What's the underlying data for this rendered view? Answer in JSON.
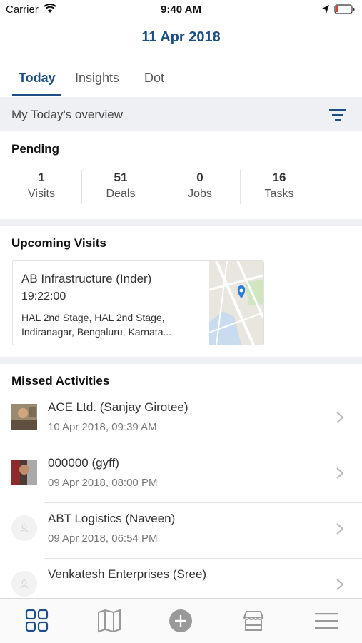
{
  "status_bar": {
    "carrier": "Carrier",
    "time": "9:40 AM",
    "icons": [
      "wifi-icon",
      "location-arrow-icon",
      "battery-icon"
    ]
  },
  "header": {
    "date": "11 Apr 2018"
  },
  "tabs": [
    {
      "label": "Today",
      "active": true
    },
    {
      "label": "Insights",
      "active": false
    },
    {
      "label": "Dot",
      "active": false
    }
  ],
  "overview": {
    "label": "My Today's overview",
    "icon": "filter-icon"
  },
  "pending": {
    "title": "Pending",
    "stats": [
      {
        "value": "1",
        "label": "Visits"
      },
      {
        "value": "51",
        "label": "Deals"
      },
      {
        "value": "0",
        "label": "Jobs"
      },
      {
        "value": "16",
        "label": "Tasks"
      }
    ]
  },
  "upcoming": {
    "title": "Upcoming Visits",
    "visit": {
      "name": "AB Infrastructure (Inder)",
      "time": "19:22:00",
      "address_line1": "HAL 2nd Stage, HAL 2nd Stage,",
      "address_line2": "Indiranagar, Bengaluru, Karnata..."
    }
  },
  "missed": {
    "title": "Missed Activities",
    "items": [
      {
        "title": "ACE Ltd. (Sanjay Girotee)",
        "time": "10 Apr 2018, 09:39 AM",
        "avatar": "photo"
      },
      {
        "title": "000000 (gyff)",
        "time": "09 Apr 2018, 08:00 PM",
        "avatar": "photo"
      },
      {
        "title": "ABT Logistics (Naveen)",
        "time": "09 Apr 2018, 06:54 PM",
        "avatar": "placeholder"
      },
      {
        "title": "Venkatesh Enterprises (Sree)",
        "time": "",
        "avatar": "placeholder"
      }
    ]
  },
  "bottom_nav": [
    "grid-icon",
    "map-icon",
    "add-icon",
    "store-icon",
    "menu-icon"
  ],
  "colors": {
    "accent": "#1d4f86",
    "section_bg": "#eff0f3",
    "text": "#333333",
    "muted": "#777777"
  }
}
